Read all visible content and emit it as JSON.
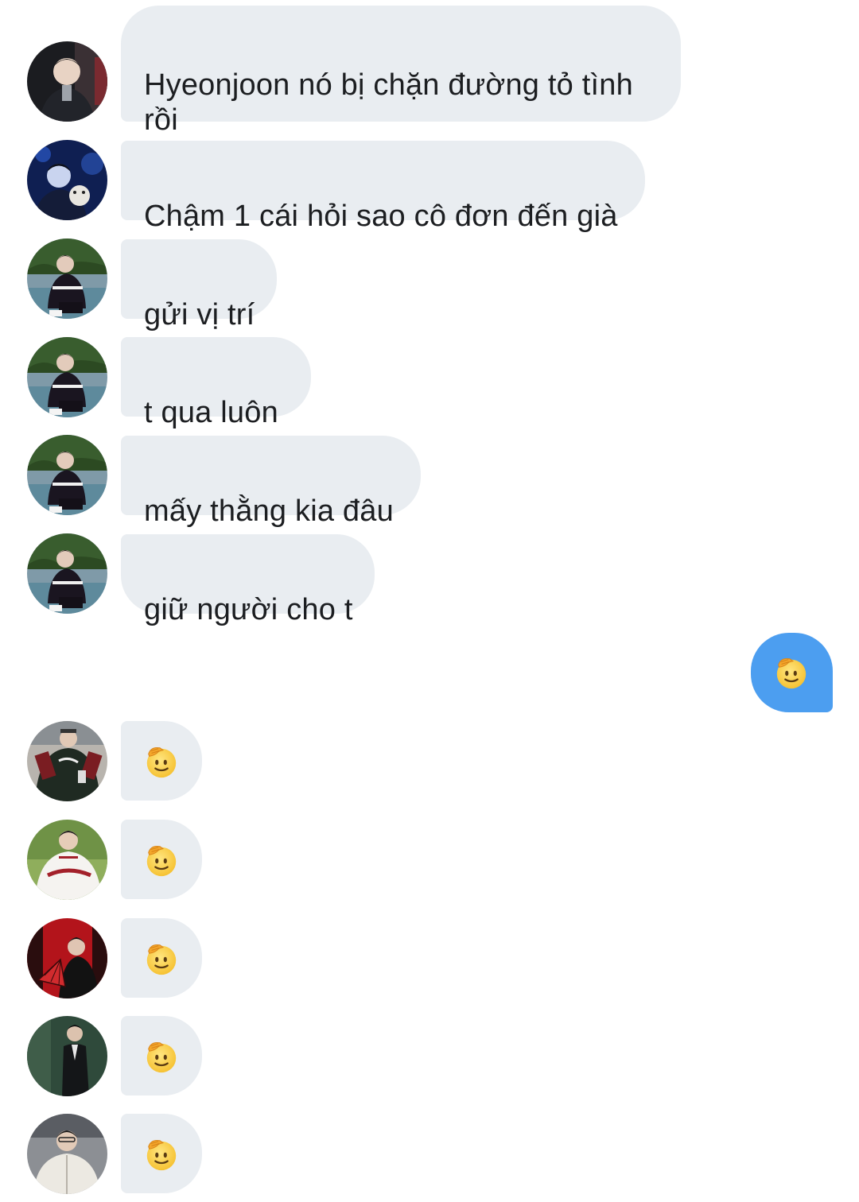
{
  "conversation": {
    "messages": [
      {
        "text": "Hyeonjoon nó bị chặn đường tỏ tình\nrồi",
        "avatar": "avatar-dark-jacket"
      },
      {
        "text": "Chậm 1 cái hỏi sao cô đơn đến già",
        "avatar": "avatar-blue-stage"
      },
      {
        "text": "gửi vị trí",
        "avatar": "avatar-outdoor-field"
      },
      {
        "text": "t qua luôn",
        "avatar": "avatar-outdoor-field"
      },
      {
        "text": "mấy thằng kia đâu",
        "avatar": "avatar-outdoor-field"
      },
      {
        "text": "giữ người cho t",
        "avatar": "avatar-outdoor-field"
      }
    ],
    "my_reply": {
      "emoji": "saluting-face"
    },
    "emoji_replies": [
      {
        "emoji": "saluting-face",
        "avatar": "avatar-baseball-jacket"
      },
      {
        "emoji": "saluting-face",
        "avatar": "avatar-white-jersey"
      },
      {
        "emoji": "saluting-face",
        "avatar": "avatar-red-fan"
      },
      {
        "emoji": "saluting-face",
        "avatar": "avatar-dark-suit"
      },
      {
        "emoji": "saluting-face",
        "avatar": "avatar-white-fleece"
      }
    ]
  },
  "colors": {
    "incoming_bubble": "#e9edf1",
    "outgoing_bubble": "#4c9ef0",
    "text": "#1c1e21"
  }
}
